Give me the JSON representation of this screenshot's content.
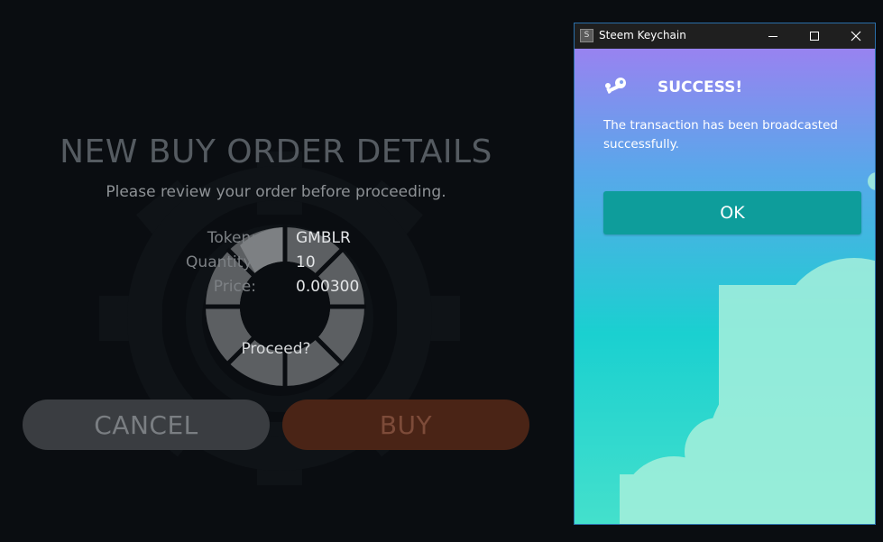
{
  "app": {
    "title": "NEW BUY ORDER DETAILS",
    "subtitle": "Please review your order before proceeding.",
    "rows": [
      {
        "label": "Token:",
        "value": "GMBLR"
      },
      {
        "label": "Quantity:",
        "value": "10"
      },
      {
        "label": "Price:",
        "value": "0.00300"
      }
    ],
    "proceed": "Proceed?",
    "cancel_label": "CANCEL",
    "buy_label": "BUY"
  },
  "keychain": {
    "window_title": "Steem Keychain",
    "app_icon_glyph": "S",
    "heading": "SUCCESS!",
    "message": "The transaction has been broadcasted successfully.",
    "ok_label": "OK",
    "icons": [
      "key-icon",
      "minimize-icon",
      "maximize-icon",
      "close-icon"
    ]
  },
  "colors": {
    "background": "#0a0d11",
    "cancel_button": "#3a3d41",
    "buy_button": "#4a2416",
    "ok_button": "#0e9d9b",
    "gradient_top": "#a57bf2",
    "gradient_bottom": "#44e0cc"
  }
}
